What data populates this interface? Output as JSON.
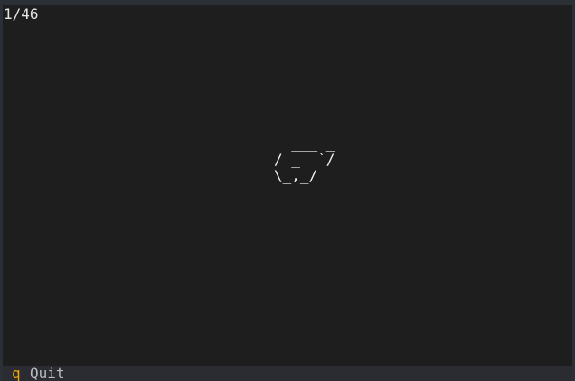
{
  "pager": {
    "counter": "1/46"
  },
  "content": {
    "ascii_art": "  ___ _\n/ _  `/\n\\_,_/"
  },
  "status_bar": {
    "key": "q",
    "label": "Quit"
  },
  "colors": {
    "background": "#1e1e1e",
    "status_bar_bg": "#2a2c31",
    "key_accent": "#f0a30a",
    "text": "#e6e6e6"
  }
}
